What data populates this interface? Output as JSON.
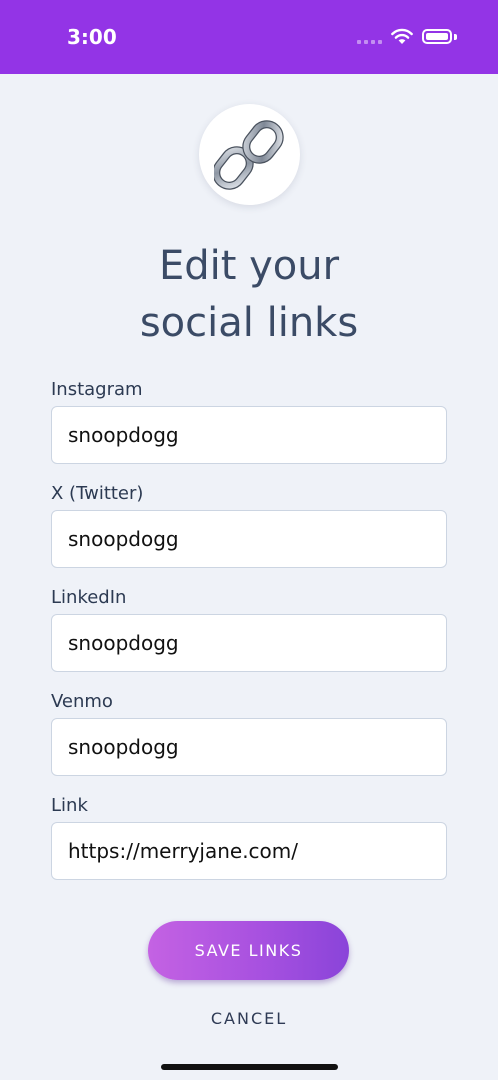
{
  "status_bar": {
    "time": "3:00"
  },
  "header": {
    "title_line1": "Edit your",
    "title_line2": "social links",
    "icon": "link-icon"
  },
  "fields": [
    {
      "label": "Instagram",
      "value": "snoopdogg"
    },
    {
      "label": "X (Twitter)",
      "value": "snoopdogg"
    },
    {
      "label": "LinkedIn",
      "value": "snoopdogg"
    },
    {
      "label": "Venmo",
      "value": "snoopdogg"
    },
    {
      "label": "Link",
      "value": "https://merryjane.com/"
    }
  ],
  "actions": {
    "save_label": "SAVE LINKS",
    "cancel_label": "CANCEL"
  },
  "colors": {
    "status_bar": "#9334e6",
    "background": "#eff2f8",
    "title": "#3b4b66",
    "button_start": "#c462e3",
    "button_end": "#8a44d9"
  }
}
